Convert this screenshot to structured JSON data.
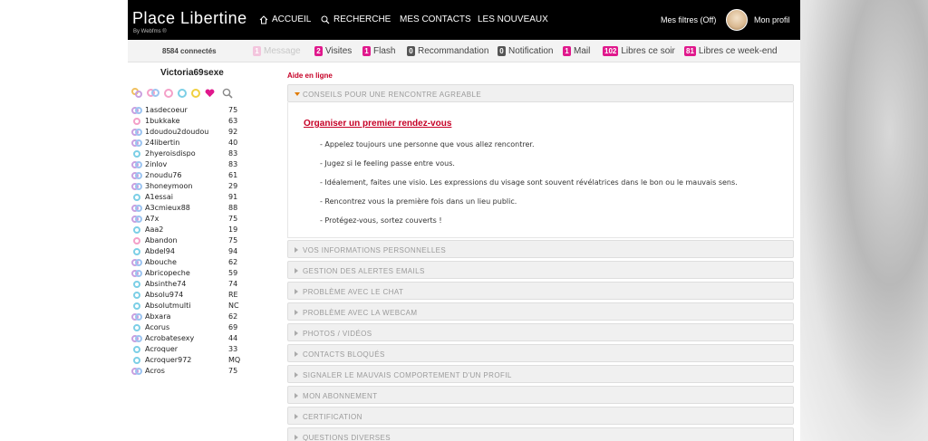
{
  "header": {
    "logo_part1": "Place",
    "logo_part2": "Libertine",
    "tagline": "By Webfms ®",
    "nav": [
      "ACCUEIL",
      "RECHERCHE",
      "MES CONTACTS",
      "LES NOUVEAUX"
    ],
    "filters": "Mes filtres (Off)",
    "profile": "Mon profil"
  },
  "stats": {
    "connected": "8584 connectés",
    "items": [
      {
        "badge": "1",
        "label": "Message",
        "color": "light",
        "muted": true
      },
      {
        "badge": "2",
        "label": "Visites",
        "color": "pink",
        "muted": false
      },
      {
        "badge": "1",
        "label": "Flash",
        "color": "pink",
        "muted": false
      },
      {
        "badge": "0",
        "label": "Recommandation",
        "color": "grey",
        "muted": false
      },
      {
        "badge": "0",
        "label": "Notification",
        "color": "grey",
        "muted": false
      },
      {
        "badge": "1",
        "label": "Mail",
        "color": "pink",
        "muted": false
      },
      {
        "badge": "102",
        "label": "Libres ce soir",
        "color": "pink",
        "muted": false
      },
      {
        "badge": "81",
        "label": "Libres ce week-end",
        "color": "pink",
        "muted": false
      }
    ]
  },
  "sidebar": {
    "username": "Victoria69sexe",
    "members": [
      {
        "name": "1asdecoeur",
        "age": "75",
        "type": "couple"
      },
      {
        "name": "1bukkake",
        "age": "63",
        "type": "woman"
      },
      {
        "name": "1doudou2doudou",
        "age": "92",
        "type": "couple"
      },
      {
        "name": "24libertin",
        "age": "40",
        "type": "couple"
      },
      {
        "name": "2hyeroisdispo",
        "age": "83",
        "type": "man"
      },
      {
        "name": "2inlov",
        "age": "83",
        "type": "couple"
      },
      {
        "name": "2noudu76",
        "age": "61",
        "type": "couple"
      },
      {
        "name": "3honeymoon",
        "age": "29",
        "type": "couple"
      },
      {
        "name": "A1essai",
        "age": "91",
        "type": "man"
      },
      {
        "name": "A3cmieux88",
        "age": "88",
        "type": "couple"
      },
      {
        "name": "A7x",
        "age": "75",
        "type": "couple"
      },
      {
        "name": "Aaa2",
        "age": "19",
        "type": "man"
      },
      {
        "name": "Abandon",
        "age": "75",
        "type": "woman"
      },
      {
        "name": "Abdel94",
        "age": "94",
        "type": "man"
      },
      {
        "name": "Abouche",
        "age": "62",
        "type": "couple"
      },
      {
        "name": "Abricopeche",
        "age": "59",
        "type": "couple"
      },
      {
        "name": "Absinthe74",
        "age": "74",
        "type": "man"
      },
      {
        "name": "Absolu974",
        "age": "RE",
        "type": "man"
      },
      {
        "name": "Absolutmulti",
        "age": "NC",
        "type": "man"
      },
      {
        "name": "Abxara",
        "age": "62",
        "type": "couple"
      },
      {
        "name": "Acorus",
        "age": "69",
        "type": "man"
      },
      {
        "name": "Acrobatesexy",
        "age": "44",
        "type": "couple"
      },
      {
        "name": "Acroquer",
        "age": "33",
        "type": "man"
      },
      {
        "name": "Acroquer972",
        "age": "MQ",
        "type": "man"
      },
      {
        "name": "Acros",
        "age": "75",
        "type": "couple"
      }
    ]
  },
  "main": {
    "title": "Aide en ligne",
    "sections": [
      "CONSEILS POUR UNE RENCONTRE AGREABLE",
      "VOS INFORMATIONS PERSONNELLES",
      "GESTION DES ALERTES EMAILS",
      "PROBLÈME AVEC LE CHAT",
      "PROBLÈME AVEC LA WEBCAM",
      "PHOTOS / VIDÉOS",
      "CONTACTS BLOQUÉS",
      "SIGNALER LE MAUVAIS COMPORTEMENT D'UN PROFIL",
      "MON ABONNEMENT",
      "CERTIFICATION",
      "QUESTIONS DIVERSES"
    ],
    "panel": {
      "heading": "Organiser un premier rendez-vous",
      "lines": [
        "- Appelez toujours une personne que vous allez rencontrer.",
        "- Jugez si le feeling passe entre vous.",
        "- Idéalement, faites une visio. Les expressions du visage sont souvent révélatrices dans le bon ou le mauvais sens.",
        "- Rencontrez vous la première fois dans un lieu public.",
        "- Protégez-vous, sortez couverts !"
      ]
    }
  },
  "colors": {
    "accent": "#e0188c",
    "title_red": "#c60026",
    "woman": "#f4a0c8",
    "man": "#7ccfe6",
    "couple_a": "#c9a0e0",
    "couple_b": "#9cc4f0"
  }
}
